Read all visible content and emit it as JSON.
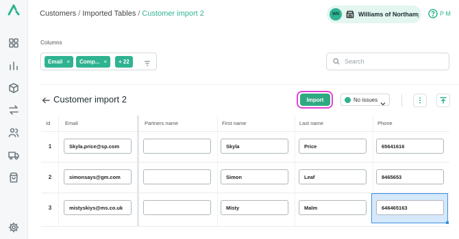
{
  "breadcrumb": {
    "items": [
      "Customers",
      "Imported Tables"
    ],
    "current": "Customer import 2",
    "separator": "/"
  },
  "org": {
    "initials": "WN",
    "name": "Williams of Northampton"
  },
  "help": {
    "label": "P M"
  },
  "columns_filter": {
    "label": "Columns",
    "chips": [
      {
        "label": "Email",
        "remove": "×"
      },
      {
        "label": "Comp...",
        "remove": "×"
      },
      {
        "label": "+ 22"
      }
    ]
  },
  "search": {
    "placeholder": "Search",
    "value": ""
  },
  "page": {
    "title": "Customer import 2"
  },
  "toolbar": {
    "import_label": "Import",
    "issues_filter": "No issues"
  },
  "table": {
    "columns": [
      "Id",
      "Email",
      "Partners name",
      "First name",
      "Last name",
      "Phone"
    ],
    "rows": [
      {
        "id": "1",
        "email": "Skyla.price@sp.com",
        "partners_name": "",
        "first_name": "Skyla",
        "last_name": "Price",
        "phone": "65641616"
      },
      {
        "id": "2",
        "email": "simonsays@gm.com",
        "partners_name": "",
        "first_name": "Simon",
        "last_name": "Leaf",
        "phone": "8465653"
      },
      {
        "id": "3",
        "email": "mistyskiys@ms.co.uk",
        "partners_name": "",
        "first_name": "Misty",
        "last_name": "Malm",
        "phone": "646465163"
      }
    ],
    "selected_cell": {
      "row": 3,
      "column": "Phone"
    }
  },
  "sidebar": {
    "icons": [
      "logo-icon",
      "dashboard-icon",
      "analytics-icon",
      "products-icon",
      "transfers-icon",
      "customers-icon",
      "shipping-icon",
      "orders-icon",
      "settings-icon"
    ]
  },
  "colors": {
    "accent": "#2fb391",
    "highlight_ring": "#e43ed3",
    "selection": "#3a8ee6"
  }
}
